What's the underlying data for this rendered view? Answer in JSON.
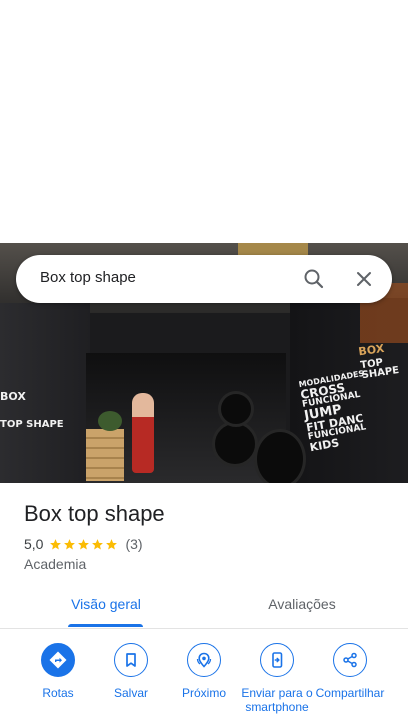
{
  "search": {
    "query": "Box top shape"
  },
  "photo": {
    "sign_lines": [
      "BOX",
      "TOP SHAPE"
    ],
    "sign_right": [
      "Modalidades",
      "CROSS",
      "FUNCIONAL",
      "JUMP",
      "FIT DANC",
      "FUNCIONAL",
      "KIDS"
    ]
  },
  "place": {
    "name": "Box top shape",
    "rating": "5,0",
    "stars": 5,
    "review_count": "(3)",
    "category": "Academia"
  },
  "tabs": [
    {
      "label": "Visão geral",
      "active": true
    },
    {
      "label": "Avaliações",
      "active": false
    }
  ],
  "actions": [
    {
      "label": "Rotas",
      "icon": "directions-icon"
    },
    {
      "label": "Salvar",
      "icon": "bookmark-icon"
    },
    {
      "label": "Próximo",
      "icon": "nearby-icon"
    },
    {
      "label": "Enviar para o smartphone",
      "icon": "send-to-phone-icon"
    },
    {
      "label": "Compartilhar",
      "icon": "share-icon"
    }
  ],
  "colors": {
    "accent": "#1a73e8",
    "star": "#fbbc04",
    "text_secondary": "#5f6368"
  }
}
